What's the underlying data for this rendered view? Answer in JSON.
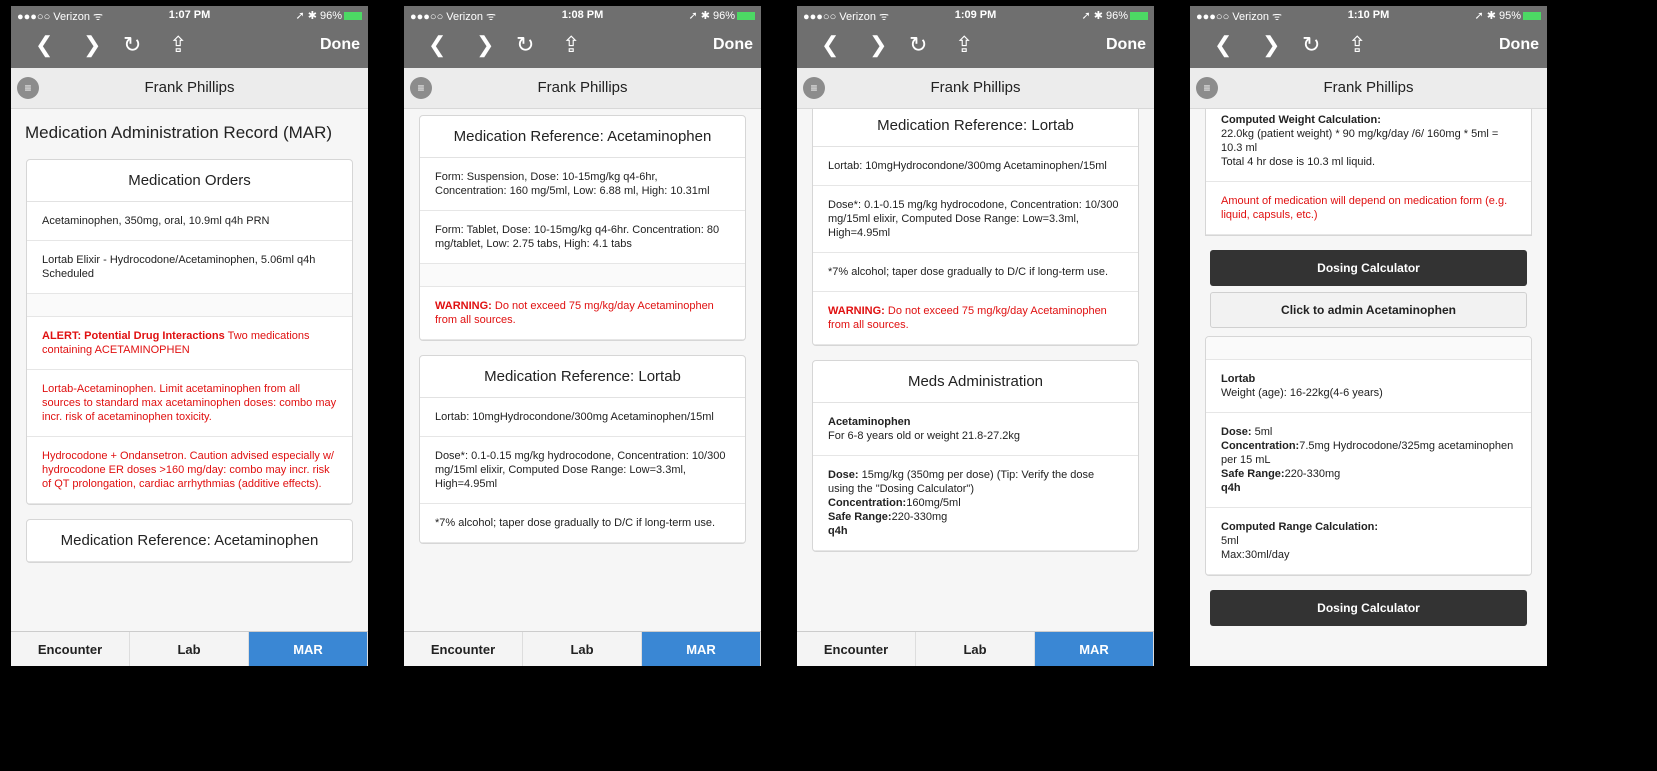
{
  "common": {
    "carrier": "●●●○○ Verizon ᯤ",
    "done": "Done",
    "patient": "Frank Phillips",
    "tabs": [
      "Encounter",
      "Lab",
      "MAR"
    ]
  },
  "screens": [
    {
      "time": "1:07 PM",
      "battery": "➚ ✱ 96%",
      "page_title": "Medication Administration Record (MAR)",
      "orders_title": "Medication Orders",
      "order1": "Acetaminophen, 350mg, oral, 10.9ml q4h PRN",
      "order2": "Lortab Elixir - Hydrocodone/Acetaminophen, 5.06ml q4h Scheduled",
      "alert_label": "ALERT: Potential Drug Interactions",
      "alert_text": " Two medications containing ACETAMINOPHEN",
      "interaction1": "Lortab-Acetaminophen. Limit acetaminophen from all sources to standard max acetaminophen doses: combo may incr. risk of acetaminophen toxicity.",
      "interaction2": "Hydrocodone + Ondansetron. Caution advised especially w/ hydrocodone ER doses >160 mg/day: combo may incr. risk of QT prolongation, cardiac arrhythmias (additive effects).",
      "next_card_title": "Medication Reference: Acetaminophen"
    },
    {
      "time": "1:08 PM",
      "battery": "➚ ✱ 96%",
      "ref_acet_title": "Medication Reference: Acetaminophen",
      "form1": "Form: Suspension, Dose: 10-15mg/kg q4-6hr, Concentration: 160 mg/5ml, Low: 6.88 ml, High: 10.31ml",
      "form2": "Form: Tablet, Dose: 10-15mg/kg q4-6hr. Concentration: 80 mg/tablet, Low: 2.75 tabs, High: 4.1 tabs",
      "warning_label": "WARNING:",
      "warning_text": " Do not exceed 75 mg/kg/day Acetaminophen from all sources.",
      "ref_lortab_title": "Medication Reference: Lortab",
      "lortab_desc": "Lortab: 10mgHydrocondone/300mg Acetaminophen/15ml",
      "lortab_dose": "Dose*: 0.1-0.15 mg/kg hydrocodone, Concentration: 10/300 mg/15ml elixir, Computed Dose Range: Low=3.3ml, High=4.95ml",
      "lortab_note": "*7% alcohol; taper dose gradually to D/C if long-term use."
    },
    {
      "time": "1:09 PM",
      "battery": "➚ ✱ 96%",
      "ref_lortab_title": "Medication Reference: Lortab",
      "lortab_desc": "Lortab: 10mgHydrocondone/300mg Acetaminophen/15ml",
      "lortab_dose": "Dose*: 0.1-0.15 mg/kg hydrocodone, Concentration: 10/300 mg/15ml elixir, Computed Dose Range: Low=3.3ml, High=4.95ml",
      "lortab_note": "*7% alcohol; taper dose gradually to D/C if long-term use.",
      "warning_label": "WARNING:",
      "warning_text": " Do not exceed 75 mg/kg/day Acetaminophen from all sources.",
      "admin_title": "Meds Administration",
      "acet_name": "Acetaminophen",
      "acet_for": "For 6-8 years old or weight 21.8-27.2kg",
      "dose_label": "Dose:",
      "dose_text": " 15mg/kg (350mg per dose) (Tip: Verify the dose using the \"Dosing Calculator\")",
      "conc_label": "Concentration:",
      "conc_text": "160mg/5ml",
      "safe_label": "Safe Range:",
      "safe_text": "220-330mg",
      "freq": "q4h"
    },
    {
      "time": "1:10 PM",
      "battery": "➚ ✱ 95%",
      "cw_label": "Computed Weight Calculation:",
      "cw_line1": "22.0kg (patient weight) * 90 mg/kg/day /6/ 160mg * 5ml = 10.3 ml",
      "cw_line2": "Total 4 hr dose is 10.3 ml liquid.",
      "amount_note": "Amount of medication will depend on medication form (e.g. liquid, capsuls, etc.)",
      "dosing_calc": "Dosing Calculator",
      "admin_button": "Click to admin Acetaminophen",
      "lortab_name": "Lortab",
      "lortab_weight": "Weight (age): 16-22kg(4-6 years)",
      "dose_label": "Dose:",
      "dose_text": " 5ml",
      "conc_label": "Concentration:",
      "conc_text": "7.5mg Hydrocodone/325mg acetaminophen per 15 mL",
      "safe_label": "Safe Range:",
      "safe_text": "220-330mg",
      "freq": "q4h",
      "cr_label": "Computed Range Calculation:",
      "cr_line1": "5ml",
      "cr_line2": "Max:30ml/day",
      "dosing_calc2": "Dosing Calculator"
    }
  ]
}
